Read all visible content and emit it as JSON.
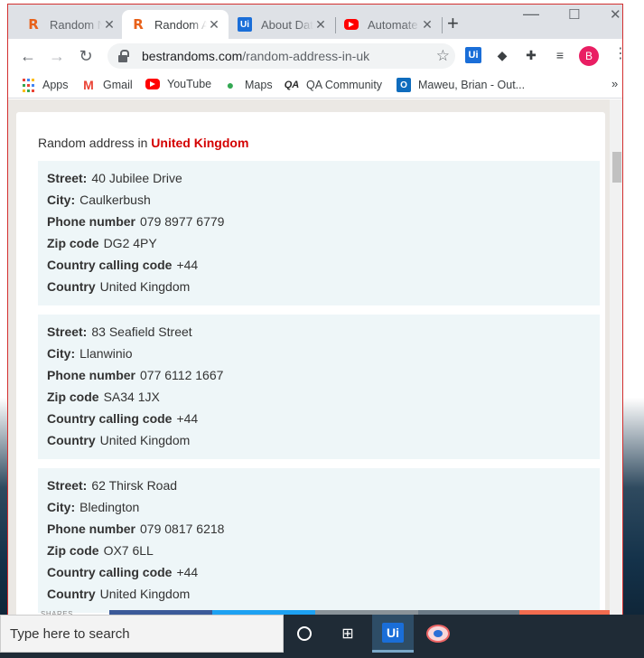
{
  "tabs": [
    {
      "title": "Random Name Generator",
      "favicon": "R",
      "active": false
    },
    {
      "title": "Random Address in UK",
      "favicon": "R",
      "active": true
    },
    {
      "title": "About Data Scraping",
      "favicon": "Ui",
      "active": false
    },
    {
      "title": "Automate",
      "favicon": "youtube-icon",
      "active": false
    }
  ],
  "toolbar": {
    "url_host": "bestrandoms.com",
    "url_path": "/random-address-in-uk",
    "profile_initial": "B"
  },
  "bookmarks": [
    {
      "label": "Apps",
      "icon": "apps-grid-icon"
    },
    {
      "label": "Gmail",
      "icon": "gmail-icon"
    },
    {
      "label": "YouTube",
      "icon": "youtube-icon"
    },
    {
      "label": "Maps",
      "icon": "maps-pin-icon"
    },
    {
      "label": "QA Community",
      "icon": "qa-icon"
    },
    {
      "label": "Maweu, Brian - Out...",
      "icon": "outlook-icon"
    }
  ],
  "page": {
    "heading_prefix": "Random address in",
    "heading_country": "United Kingdom",
    "labels": {
      "street": "Street:",
      "city": "City:",
      "phone": "Phone number",
      "zip": "Zip code",
      "calling_code": "Country calling code",
      "country": "Country"
    },
    "addresses": [
      {
        "street": "40 Jubilee Drive",
        "city": "Caulkerbush",
        "phone": "079 8977 6779",
        "zip": "DG2 4PY",
        "calling_code": "+44",
        "country": "United Kingdom"
      },
      {
        "street": "83 Seafield Street",
        "city": "Llanwinio",
        "phone": "077 6112 1667",
        "zip": "SA34 1JX",
        "calling_code": "+44",
        "country": "United Kingdom"
      },
      {
        "street": "62 Thirsk Road",
        "city": "Bledington",
        "phone": "079 0817 6218",
        "zip": "OX7 6LL",
        "calling_code": "+44",
        "country": "United Kingdom"
      }
    ],
    "shares_label": "SHARES"
  },
  "taskbar": {
    "search_placeholder": "Type here to search"
  },
  "colors": {
    "accent_red": "#d40000",
    "address_bg": "#eef6f8",
    "profile": "#e91e63"
  }
}
